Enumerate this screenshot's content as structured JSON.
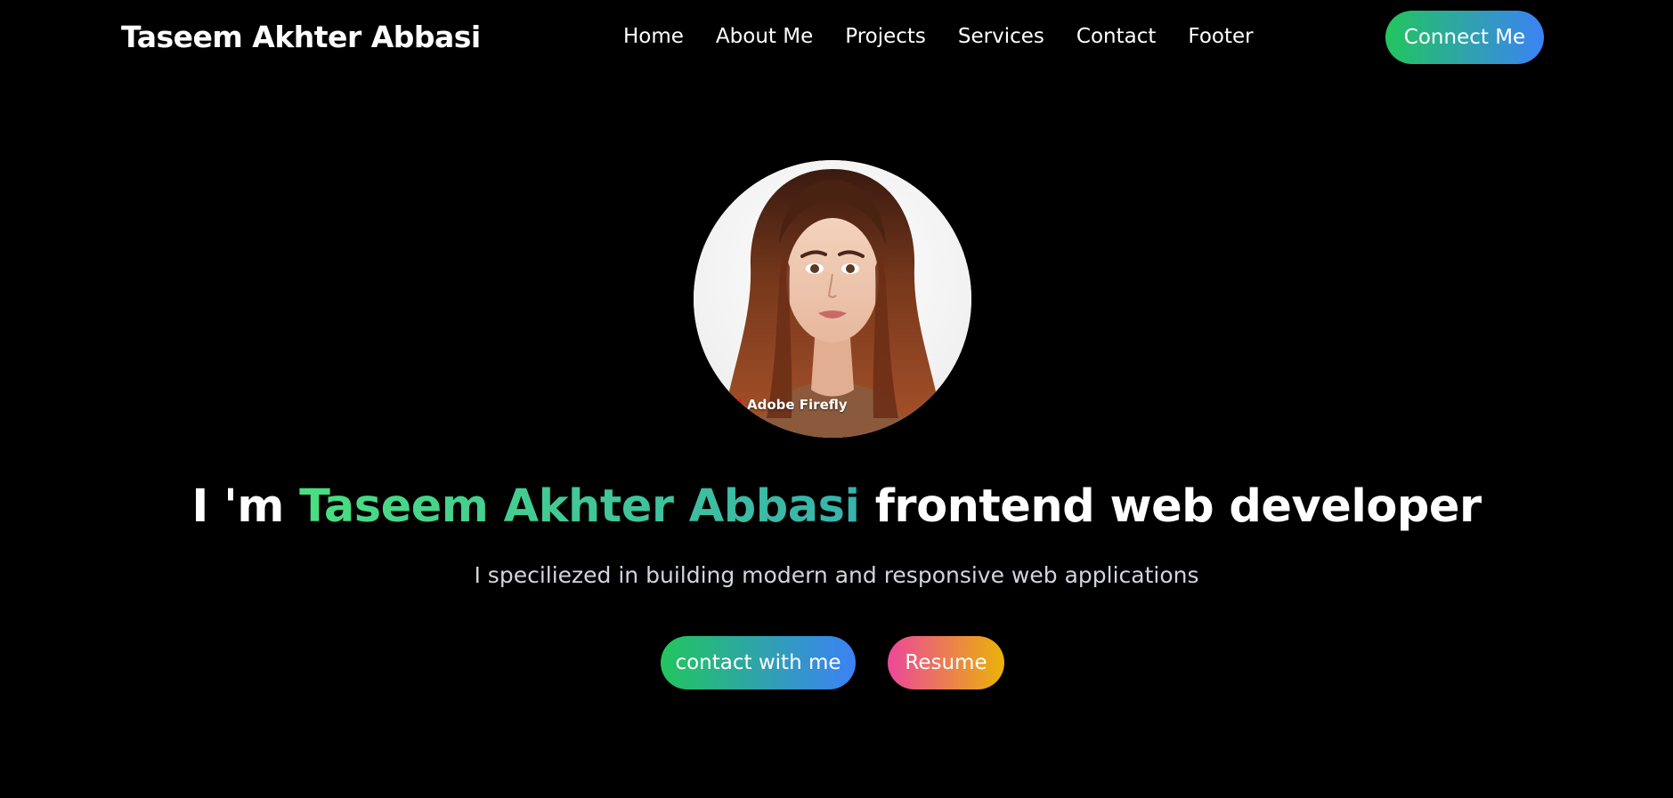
{
  "header": {
    "brand": "Taseem Akhter Abbasi",
    "nav": [
      {
        "label": "Home"
      },
      {
        "label": "About Me"
      },
      {
        "label": "Projects"
      },
      {
        "label": "Services"
      },
      {
        "label": "Contact"
      },
      {
        "label": "Footer"
      }
    ],
    "connect_label": "Connect Me"
  },
  "hero": {
    "avatar_badge": "Adobe Firefly",
    "headline_prefix": "I 'm ",
    "headline_name": "Taseem Akhter Abbasi",
    "headline_suffix": " frontend web developer",
    "subtitle": "I speciliezed in building modern and responsive web applications",
    "buttons": {
      "contact": "contact with me",
      "resume": "Resume"
    }
  },
  "colors": {
    "background": "#000000",
    "gradient_green": "#22c55e",
    "gradient_blue": "#3b82f6",
    "gradient_pink": "#ec4899",
    "gradient_amber": "#eab308",
    "accent_text": "#4ade80"
  }
}
